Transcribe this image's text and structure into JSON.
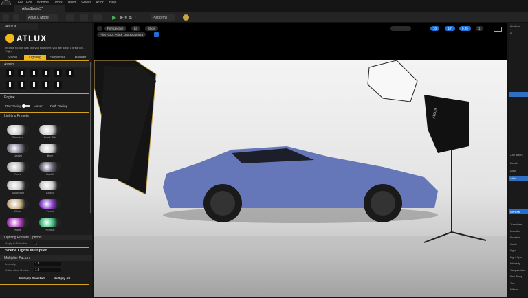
{
  "menu": [
    "File",
    "Edit",
    "Window",
    "Tools",
    "Build",
    "Select",
    "Actor",
    "Help"
  ],
  "doc_tab": "AtluxStudio3*",
  "toolbar": {
    "mode": "Atlux X Mode",
    "platforms": "Platforms"
  },
  "left_panel": {
    "tab": "Atlux X",
    "brand": "ATLUX",
    "quote": "In case no one has told you today yet, you are doing a great job. - Yujin",
    "tabs": [
      "Studio",
      "Lighting",
      "Sequence",
      "Render"
    ],
    "active_tab": "Lighting",
    "assets_label": "Assets",
    "engine_label": "Engine",
    "raytracing": "RayTracing",
    "lumen": "Lumen",
    "path_tracing": "Path Tracing",
    "presets_label": "Lighting Presets",
    "presets": [
      "Standard",
      "Good Side",
      "Ueidal",
      "Bare",
      "Front",
      "Backlit",
      "Showcase",
      "Closed",
      "Warm",
      "Focus",
      "Kobe",
      "Normal"
    ],
    "preset_options": "Lighting Presets Options",
    "apply_selection": "Apply to Selection",
    "multiplier_title": "Scene Lights Multiplier",
    "multiplier_factors": "Multiplier Factors",
    "intensity_label": "Intensity",
    "intensity_value": "1.0",
    "attenuation_label": "Attenuation Radius",
    "attenuation_value": "1.0",
    "multiply_selected": "Multiply Selected",
    "multiply_all": "Multiply All"
  },
  "viewport": {
    "perspective": "Perspective",
    "lit": "Lit",
    "show": "Show",
    "pilot": "Pilot Actor: Atlux_DSLRCamera",
    "grid": "10",
    "angle": "10°",
    "scale": "0.25",
    "camspeed": "1",
    "softbox_brand": "ATLUX"
  },
  "right_panel": {
    "outliner": "Outliner",
    "actors": "230 actors",
    "details": "Details",
    "items": [
      "Atlux",
      "Atlux"
    ],
    "general": "General",
    "sections": [
      "Transform",
      "Location",
      "Rotation",
      "Scale",
      "Light",
      "Light Type",
      "Intensity",
      "Temperature",
      "Use Temp",
      "Tint",
      "Diffuse"
    ]
  },
  "colors": {
    "accent": "#d4a21f",
    "selection": "#2f6fc4"
  }
}
